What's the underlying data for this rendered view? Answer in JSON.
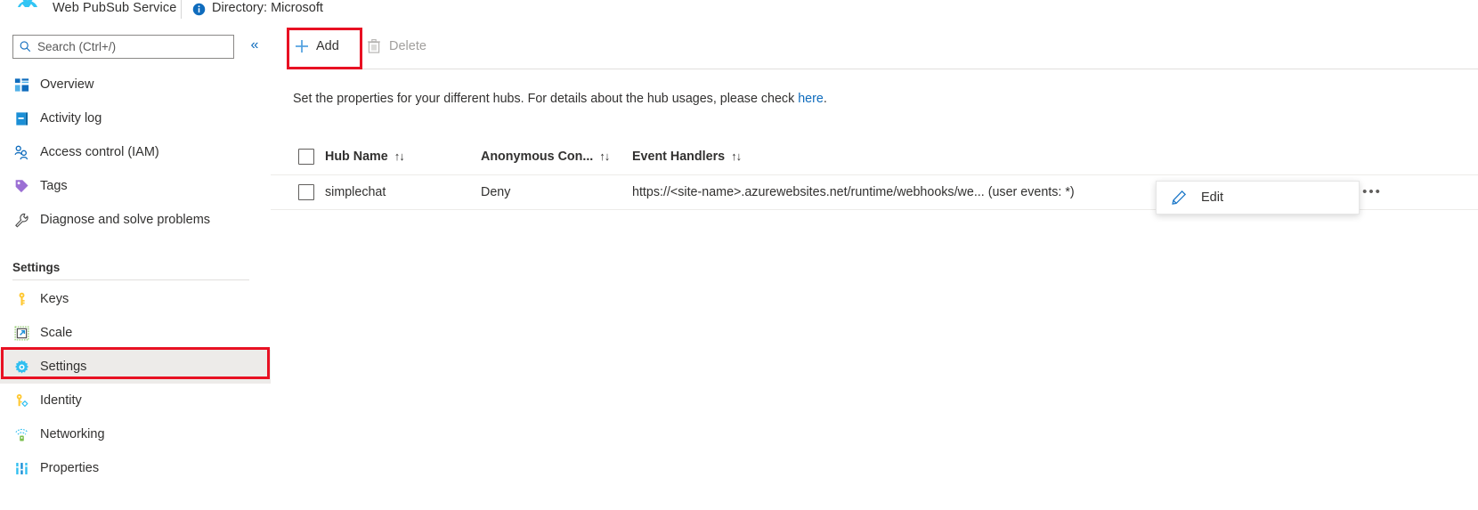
{
  "topbar": {
    "logo_icon": "azure-logo-icon",
    "service_name": "Web PubSub Service",
    "info_icon": "info-icon",
    "directory": "Directory: Microsoft"
  },
  "sidebar": {
    "search": {
      "placeholder": "Search (Ctrl+/)",
      "value": "",
      "icon": "search-icon"
    },
    "collapse_glyph": "«",
    "items": [
      {
        "label": "Overview",
        "icon": "overview-icon",
        "selected": false
      },
      {
        "label": "Activity log",
        "icon": "activity-log-icon",
        "selected": false
      },
      {
        "label": "Access control (IAM)",
        "icon": "access-control-icon",
        "selected": false
      },
      {
        "label": "Tags",
        "icon": "tag-icon",
        "selected": false
      },
      {
        "label": "Diagnose and solve problems",
        "icon": "wrench-icon",
        "selected": false
      }
    ],
    "group_label": "Settings",
    "settings_items": [
      {
        "label": "Keys",
        "icon": "key-icon",
        "selected": false
      },
      {
        "label": "Scale",
        "icon": "scale-icon",
        "selected": false
      },
      {
        "label": "Settings",
        "icon": "gear-icon",
        "selected": true
      },
      {
        "label": "Identity",
        "icon": "identity-key-icon",
        "selected": false
      },
      {
        "label": "Networking",
        "icon": "networking-icon",
        "selected": false
      },
      {
        "label": "Properties",
        "icon": "properties-icon",
        "selected": false
      }
    ]
  },
  "toolbar": {
    "add_label": "Add",
    "add_icon": "plus-icon",
    "delete_label": "Delete",
    "delete_icon": "trash-icon"
  },
  "main": {
    "description_prefix": "Set the properties for your different hubs. For details about the hub usages, please check ",
    "description_link": "here",
    "description_suffix": ".",
    "table": {
      "columns": [
        {
          "label": "Hub Name",
          "sort_glyph": "↑↓"
        },
        {
          "label": "Anonymous Con...",
          "sort_glyph": "↑↓"
        },
        {
          "label": "Event Handlers",
          "sort_glyph": "↑↓"
        }
      ],
      "rows": [
        {
          "hub_name": "simplechat",
          "anonymous_connect": "Deny",
          "event_handlers": "https://<site-name>.azurewebsites.net/runtime/webhooks/we... (user events: *)",
          "more_glyph": "•••"
        }
      ]
    },
    "context_menu": {
      "items": [
        {
          "label": "Edit",
          "icon": "pencil-icon"
        }
      ]
    }
  },
  "colors": {
    "accent": "#0f6cbd",
    "highlight_red": "#e81123",
    "selected_row_bg": "#edebe9",
    "text": "#323130",
    "disabled_text": "#a19f9d"
  }
}
